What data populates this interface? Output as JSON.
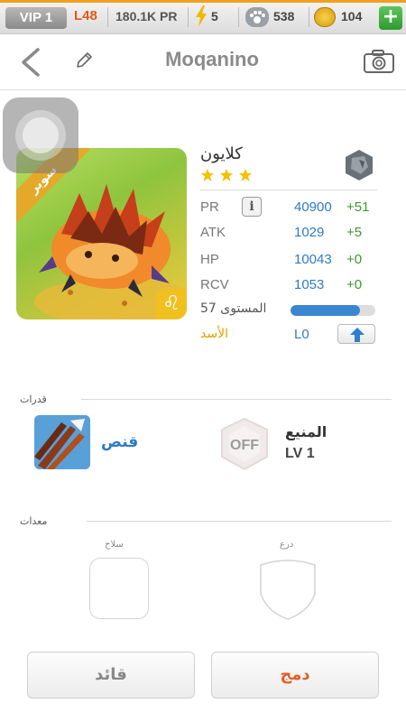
{
  "topbar": {
    "vip": "VIP 1",
    "level": "L48",
    "pr": "180.1K PR",
    "energy": "5",
    "paws": "538",
    "coins": "104",
    "add_label": "+",
    "accent_color": "#f0a020"
  },
  "header": {
    "title": "Moqanino",
    "back_icon": "chevron-left-icon",
    "edit_icon": "pencil-icon",
    "camera_icon": "camera-icon"
  },
  "monster": {
    "name": "كلايون",
    "rarity_ribbon": "سوبر",
    "stars": 3,
    "element_icon": "rock-icon",
    "zodiac_glyph": "♌",
    "stats": [
      {
        "name": "PR",
        "value": "40900",
        "delta": "+51"
      },
      {
        "name": "ATK",
        "value": "1029",
        "delta": "+5"
      },
      {
        "name": "HP",
        "value": "10043",
        "delta": "+0"
      },
      {
        "name": "RCV",
        "value": "1053",
        "delta": "+0"
      }
    ],
    "info_label": "i",
    "level_label": "المستوى 57",
    "xp_fraction": 0.82,
    "zodiac_label": "الأسد",
    "league_code": "L0"
  },
  "abilities": {
    "section_title": "قدرات",
    "skill_name": "قنص",
    "passive_badge": "OFF",
    "passive_name": "المنيع",
    "passive_level": "LV 1"
  },
  "equipment": {
    "section_title": "معدات",
    "weapon_label": "سلاح",
    "armor_label": "درع"
  },
  "actions": {
    "leader_label": "قائد",
    "merge_label": "دمج"
  }
}
